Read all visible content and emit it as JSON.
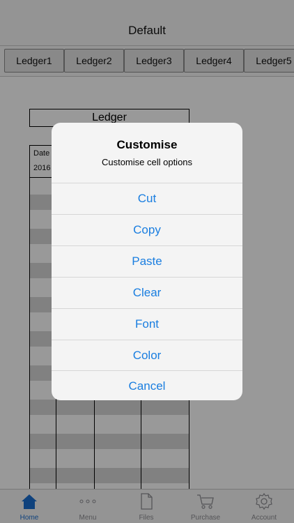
{
  "nav": {
    "title": "Default"
  },
  "ledger_tabs": [
    "Ledger1",
    "Ledger2",
    "Ledger3",
    "Ledger4",
    "Ledger5"
  ],
  "sheet": {
    "title": "Ledger",
    "header_cell": "Date",
    "first_value": "2016"
  },
  "alert": {
    "title": "Customise",
    "message": "Customise cell options",
    "options": [
      "Cut",
      "Copy",
      "Paste",
      "Clear",
      "Font",
      "Color",
      "Cancel"
    ]
  },
  "tabbar": {
    "items": [
      {
        "label": "Home",
        "icon": "home-icon",
        "active": true
      },
      {
        "label": "Menu",
        "icon": "more-icon",
        "active": false
      },
      {
        "label": "Files",
        "icon": "file-icon",
        "active": false
      },
      {
        "label": "Purchase",
        "icon": "cart-icon",
        "active": false
      },
      {
        "label": "Account",
        "icon": "gear-icon",
        "active": false
      }
    ]
  },
  "colors": {
    "accent": "#1a7ee0",
    "active_tab": "#1a6fd1",
    "inactive_tab": "#8e8e93"
  }
}
